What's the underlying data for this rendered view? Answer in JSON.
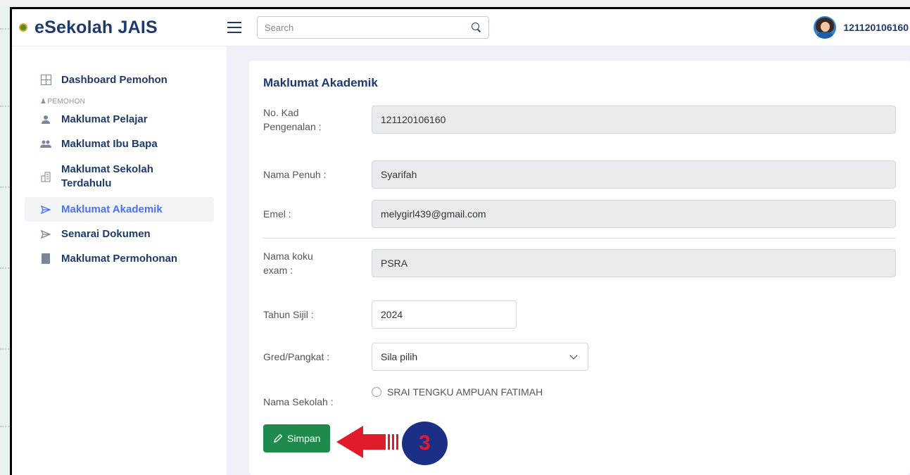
{
  "app": {
    "title": "eSekolah JAIS",
    "brand_dot_color": "#5a8a2c"
  },
  "search": {
    "placeholder": "Search"
  },
  "user": {
    "id": "121120106160"
  },
  "sidebar": {
    "items": [
      {
        "label": "Dashboard Pemohon",
        "icon": "grid-icon"
      },
      {
        "label": "Maklumat Pelajar",
        "icon": "user-icon"
      },
      {
        "label": "Maklumat Ibu Bapa",
        "icon": "users-icon"
      },
      {
        "label": "Maklumat Sekolah Terdahulu",
        "icon": "building-icon"
      },
      {
        "label": "Maklumat Akademik",
        "icon": "send-icon",
        "active": true
      },
      {
        "label": "Senarai Dokumen",
        "icon": "send-icon"
      },
      {
        "label": "Maklumat Permohonan",
        "icon": "document-icon"
      }
    ],
    "section_heading": "PEMOHON"
  },
  "form": {
    "title": "Maklumat Akademik",
    "fields": {
      "ic_label": "No. Kad Pengenalan :",
      "ic_value": "121120106160",
      "name_label": "Nama Penuh :",
      "name_value": "Syarifah",
      "email_label": "Emel :",
      "email_value": "melygirl439@gmail.com",
      "exam_label": "Nama koku exam :",
      "exam_value": "PSRA",
      "year_label": "Tahun Sijil :",
      "year_value": "2024",
      "grade_label": "Gred/Pangkat :",
      "grade_value": "Sila pilih",
      "school_label": "Nama Sekolah :",
      "school_option": "SRAI TENGKU AMPUAN FATIMAH"
    },
    "save_label": "Simpan"
  },
  "annotation": {
    "step_number": "3",
    "arrow_color": "#e21b2b",
    "badge_color": "#1c2f86"
  },
  "colors": {
    "primary_text": "#1f3a6a",
    "active_accent": "#4d6ff2",
    "save_button": "#1e8a4c"
  }
}
